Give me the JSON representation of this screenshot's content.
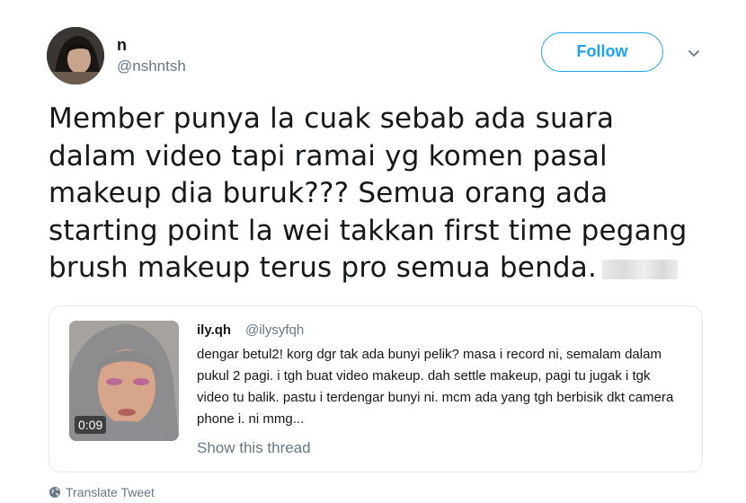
{
  "author": {
    "name": "n",
    "handle": "@nshntsh"
  },
  "follow_label": "Follow",
  "tweet": {
    "text_lines": [
      "Member punya la cuak sebab ada suara",
      "dalam video tapi ramai yg komen pasal",
      "makeup dia buruk??? Semua orang ada",
      "starting point la wei takkan first time pegang",
      "brush makeup terus pro semua benda."
    ]
  },
  "quote": {
    "name": "ily.qh",
    "handle": "@ilysyfqh",
    "text": "dengar betul2! korg dgr tak ada bunyi pelik? masa i record ni, semalam dalam pukul 2 pagi. i tgh buat video makeup. dah settle makeup, pagi tu jugak i tgk video tu balik. pastu i terdengar bunyi ni. mcm ada yang tgh berbisik dkt camera phone i. ni mmg...",
    "video_duration": "0:09",
    "thread_link": "Show this thread"
  },
  "translate_label": "Translate Tweet",
  "colors": {
    "accent": "#1da1f2",
    "muted": "#657786",
    "border": "#e1e8ed"
  },
  "icons": {
    "caret": "chevron-down-icon",
    "translate": "globe-icon"
  }
}
